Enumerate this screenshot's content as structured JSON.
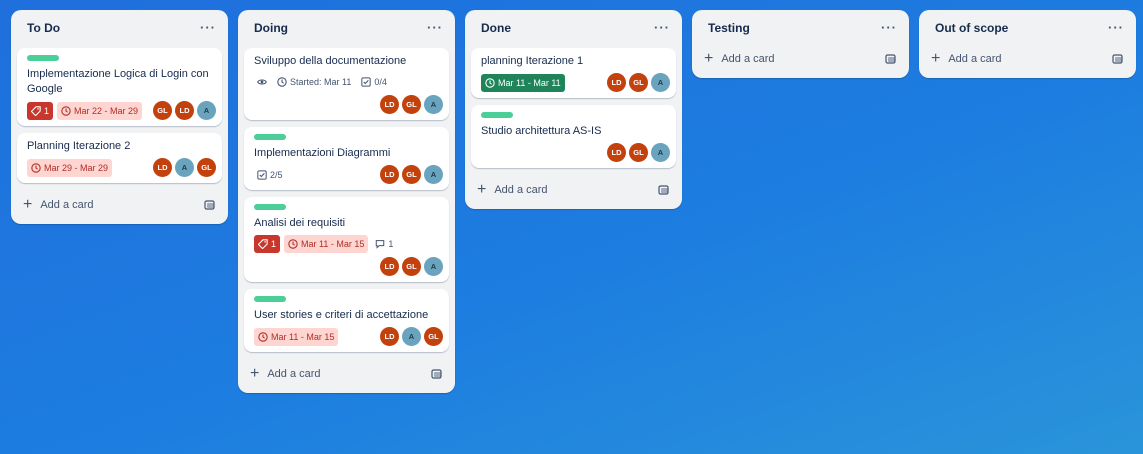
{
  "lists": [
    {
      "title": "To Do",
      "add_label": "Add a card",
      "cards": [
        {
          "title": "Implementazione Logica di Login con Google",
          "has_label": true,
          "badges": [
            {
              "kind": "priority",
              "text": "1"
            },
            {
              "kind": "date-red",
              "text": "Mar 22 - Mar 29"
            }
          ],
          "members": [
            "GL",
            "LD",
            "A"
          ]
        },
        {
          "title": "Planning Iterazione 2",
          "has_label": false,
          "badges": [
            {
              "kind": "date-red",
              "text": "Mar 29 - Mar 29"
            }
          ],
          "members": [
            "LD",
            "A",
            "GL"
          ]
        }
      ]
    },
    {
      "title": "Doing",
      "add_label": "Add a card",
      "cards": [
        {
          "title": "Sviluppo della documentazione",
          "has_label": false,
          "badges": [
            {
              "kind": "watch",
              "text": ""
            },
            {
              "kind": "started",
              "text": "Started: Mar 11"
            },
            {
              "kind": "checklist",
              "text": "0/4"
            }
          ],
          "members": [
            "LD",
            "GL",
            "A"
          ]
        },
        {
          "title": "Implementazioni Diagrammi",
          "has_label": true,
          "badges": [
            {
              "kind": "checklist",
              "text": "2/5"
            }
          ],
          "members": [
            "LD",
            "GL",
            "A"
          ]
        },
        {
          "title": "Analisi dei requisiti",
          "has_label": true,
          "badges": [
            {
              "kind": "priority",
              "text": "1"
            },
            {
              "kind": "date-red",
              "text": "Mar 11 - Mar 15"
            },
            {
              "kind": "comment",
              "text": "1"
            }
          ],
          "members": [
            "LD",
            "GL",
            "A"
          ]
        },
        {
          "title": "User stories e criteri di accettazione",
          "has_label": true,
          "badges": [
            {
              "kind": "date-red",
              "text": "Mar 11 - Mar 15"
            }
          ],
          "members": [
            "LD",
            "A",
            "GL"
          ]
        }
      ]
    },
    {
      "title": "Done",
      "add_label": "Add a card",
      "cards": [
        {
          "title": "planning Iterazione 1",
          "has_label": false,
          "badges": [
            {
              "kind": "date-green",
              "text": "Mar 11 - Mar 11"
            }
          ],
          "members": [
            "LD",
            "GL",
            "A"
          ]
        },
        {
          "title": "Studio architettura AS-IS",
          "has_label": true,
          "badges": [],
          "members": [
            "LD",
            "GL",
            "A"
          ]
        }
      ]
    },
    {
      "title": "Testing",
      "add_label": "Add a card",
      "cards": []
    },
    {
      "title": "Out of scope",
      "add_label": "Add a card",
      "cards": []
    }
  ],
  "menu_glyph": "···",
  "colors": {
    "label_green": "#4bce97",
    "priority_red": "#c9372c",
    "date_red_bg": "#ffd5d2",
    "date_green": "#1f845a",
    "avatar_orange": "#c2410c",
    "avatar_blue": "#6aa3be"
  }
}
